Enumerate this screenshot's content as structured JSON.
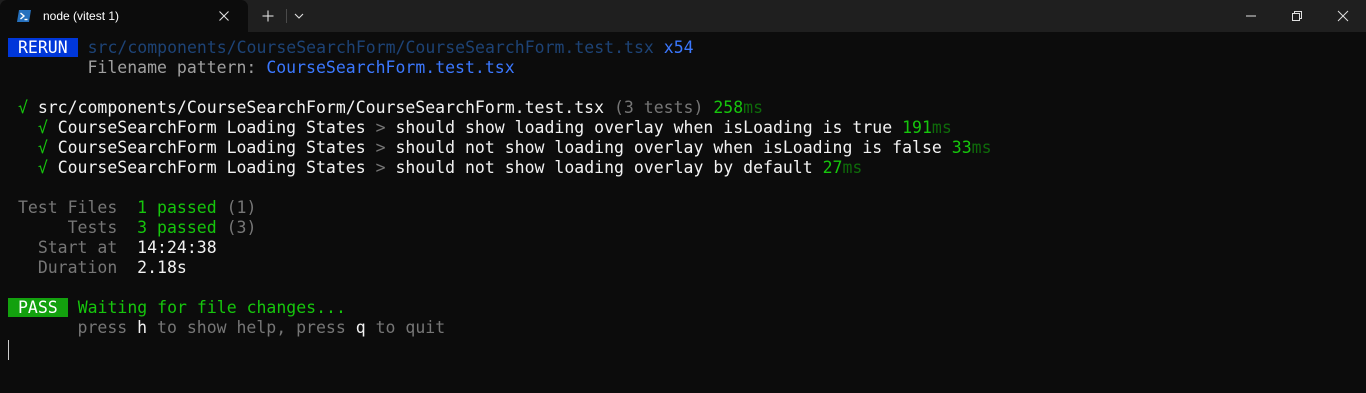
{
  "tab": {
    "title": "node (vitest 1)",
    "icon": "powershell-icon"
  },
  "colors": {
    "terminal_bg": "#0c0c0c",
    "titlebar_bg": "#1f1f1f",
    "rerun_badge": "#0037da",
    "pass_badge": "#13a10e",
    "success_green": "#16c60c",
    "link_blue": "#3b78ff"
  },
  "rerun": {
    "badge": "RERUN",
    "path": "src/components/CourseSearchForm/CourseSearchForm.test.tsx",
    "count": "x54",
    "pattern_label": "Filename pattern:",
    "pattern_value": "CourseSearchForm.test.tsx"
  },
  "suite": {
    "check": "√",
    "file": "src/components/CourseSearchForm/CourseSearchForm.test.tsx",
    "count": "(3 tests)",
    "time": "258",
    "unit": "ms"
  },
  "tests": [
    {
      "check": "√",
      "name": "CourseSearchForm Loading States",
      "sep": ">",
      "desc": "should show loading overlay when isLoading is true",
      "time": "191",
      "unit": "ms"
    },
    {
      "check": "√",
      "name": "CourseSearchForm Loading States",
      "sep": ">",
      "desc": "should not show loading overlay when isLoading is false",
      "time": "33",
      "unit": "ms"
    },
    {
      "check": "√",
      "name": "CourseSearchForm Loading States",
      "sep": ">",
      "desc": "should not show loading overlay by default",
      "time": "27",
      "unit": "ms"
    }
  ],
  "summary": {
    "test_files_label": "Test Files",
    "test_files_passed": "1 passed",
    "test_files_total": "(1)",
    "tests_label": "Tests",
    "tests_passed": "3 passed",
    "tests_total": "(3)",
    "start_label": "Start at",
    "start_value": "14:24:38",
    "duration_label": "Duration",
    "duration_value": "2.18s"
  },
  "status": {
    "badge": "PASS",
    "message": "Waiting for file changes...",
    "help_1": "press",
    "help_key_1": "h",
    "help_2": "to show help, press",
    "help_key_2": "q",
    "help_3": "to quit"
  }
}
